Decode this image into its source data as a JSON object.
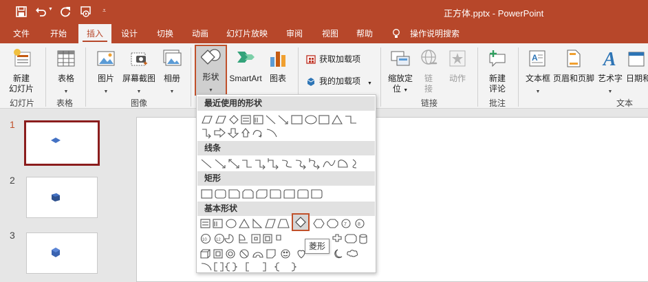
{
  "titlebar": {
    "title": "正方体.pptx - PowerPoint",
    "icons": [
      "save-icon",
      "undo-icon",
      "redo-icon",
      "present-from-start-icon",
      "customize-qat-icon"
    ]
  },
  "tabs": [
    {
      "label": "文件",
      "active": false
    },
    {
      "label": "开始",
      "active": false
    },
    {
      "label": "插入",
      "active": true
    },
    {
      "label": "设计",
      "active": false
    },
    {
      "label": "切换",
      "active": false
    },
    {
      "label": "动画",
      "active": false
    },
    {
      "label": "幻灯片放映",
      "active": false
    },
    {
      "label": "审阅",
      "active": false
    },
    {
      "label": "视图",
      "active": false
    },
    {
      "label": "帮助",
      "active": false
    },
    {
      "label": "操作说明搜索",
      "active": false
    }
  ],
  "ribbon": {
    "new_slide": {
      "line1": "新建",
      "line2": "幻灯片"
    },
    "table": "表格",
    "picture": "图片",
    "screenshot": "屏幕截图",
    "album": "相册",
    "shapes": "形状",
    "smartart": "SmartArt",
    "chart": "图表",
    "get_addins": "获取加载项",
    "my_addins": "我的加载项",
    "zoom": {
      "line1": "缩放定",
      "line2": "位"
    },
    "link": {
      "line1": "链",
      "line2": "接"
    },
    "action": "动作",
    "new_comment": {
      "line1": "新建",
      "line2": "评论"
    },
    "textbox": "文本框",
    "header_footer": "页眉和页脚",
    "wordart": "艺术字",
    "datetime": "日期和",
    "groups": {
      "slides": "幻灯片",
      "tables": "表格",
      "images": "图像",
      "links": "链接",
      "comments": "批注",
      "text": "文本"
    }
  },
  "slides": [
    {
      "number": "1",
      "selected": true
    },
    {
      "number": "2",
      "selected": false
    },
    {
      "number": "3",
      "selected": false
    }
  ],
  "gallery": {
    "categories": {
      "recent": "最近使用的形状",
      "lines": "线条",
      "rectangles": "矩形",
      "basic": "基本形状"
    },
    "hovered_shape": "rhombus",
    "tooltip": "菱形"
  },
  "colors": {
    "accent": "#b7472a",
    "slide_selected_border": "#8b1d1d",
    "shape_fill": "#4472c4"
  }
}
